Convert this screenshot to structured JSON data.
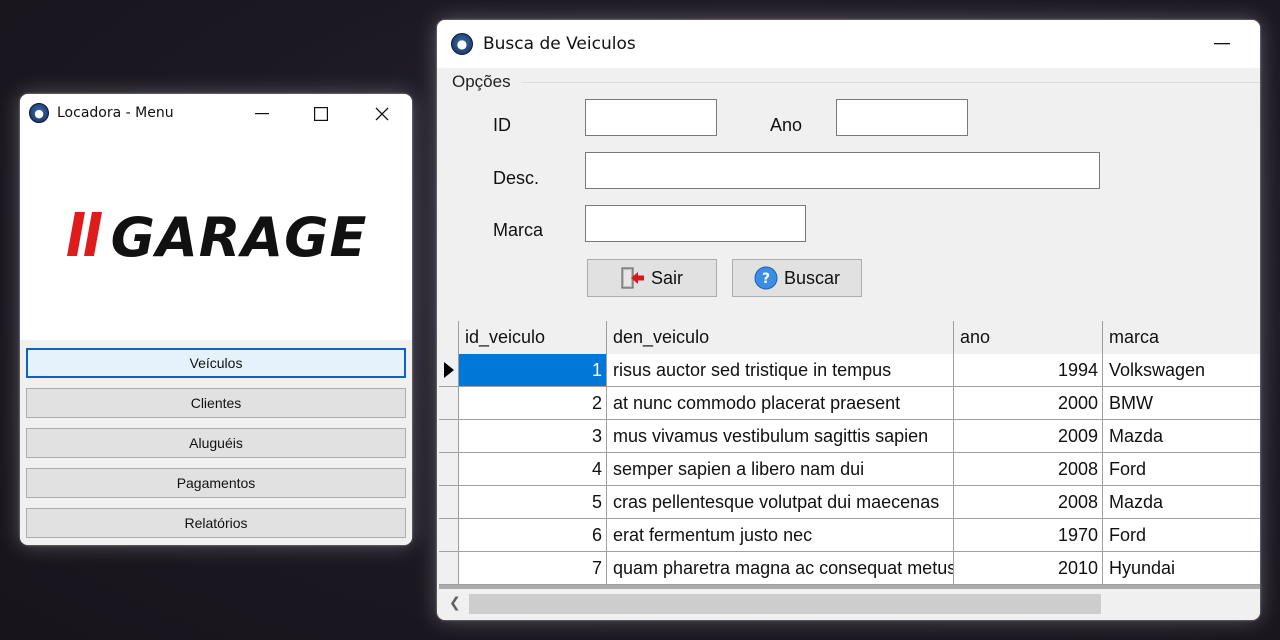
{
  "menu_window": {
    "title": "Locadora - Menu",
    "logo_text": "GARAGE",
    "logo_slashes": "//",
    "buttons": [
      "Veículos",
      "Clientes",
      "Aluguéis",
      "Pagamentos",
      "Relatórios"
    ],
    "accent_color": "#e01b1b"
  },
  "search_window": {
    "title": "Busca de Veiculos",
    "group_title": "Opções",
    "labels": {
      "id": "ID",
      "ano": "Ano",
      "desc": "Desc.",
      "marca": "Marca"
    },
    "inputs": {
      "id": "",
      "ano": "",
      "desc": "",
      "marca": ""
    },
    "buttons": {
      "sair": "Sair",
      "buscar": "Buscar"
    },
    "grid": {
      "columns": [
        "id_veiculo",
        "den_veiculo",
        "ano",
        "marca"
      ],
      "rows": [
        [
          "1",
          "risus auctor sed tristique in tempus",
          "1994",
          "Volkswagen"
        ],
        [
          "2",
          "at nunc commodo placerat praesent",
          "2000",
          "BMW"
        ],
        [
          "3",
          "mus vivamus vestibulum sagittis sapien",
          "2009",
          "Mazda"
        ],
        [
          "4",
          "semper sapien a libero nam dui",
          "2008",
          "Ford"
        ],
        [
          "5",
          "cras pellentesque volutpat dui maecenas",
          "2008",
          "Mazda"
        ],
        [
          "6",
          "erat fermentum justo nec",
          "1970",
          "Ford"
        ],
        [
          "7",
          "quam pharetra magna ac consequat metus",
          "2010",
          "Hyundai"
        ]
      ],
      "selected_row": 0
    }
  }
}
